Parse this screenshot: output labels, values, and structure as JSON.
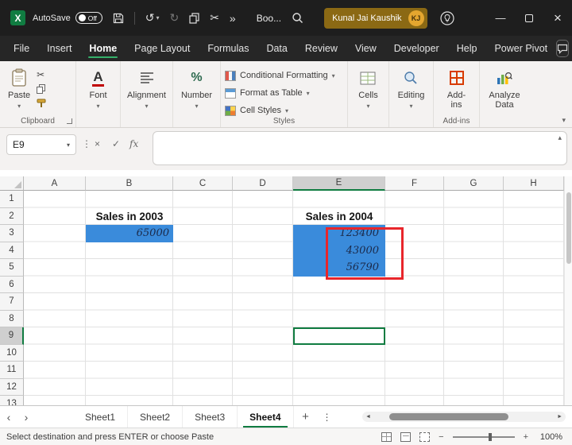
{
  "titlebar": {
    "autosave_label": "AutoSave",
    "autosave_state": "Off",
    "workbook_name": "Boo...",
    "user_name": "Kunal Jai Kaushik",
    "user_initials": "KJ",
    "logo_letter": "X"
  },
  "menu": {
    "items": [
      "File",
      "Insert",
      "Home",
      "Page Layout",
      "Formulas",
      "Data",
      "Review",
      "View",
      "Developer",
      "Help",
      "Power Pivot"
    ],
    "active": "Home"
  },
  "ribbon": {
    "paste": "Paste",
    "clipboard_group": "Clipboard",
    "font": "Font",
    "alignment": "Alignment",
    "number": "Number",
    "conditional_formatting": "Conditional Formatting",
    "format_as_table": "Format as Table",
    "cell_styles": "Cell Styles",
    "styles_group": "Styles",
    "cells": "Cells",
    "editing": "Editing",
    "addins": "Add-ins",
    "addins_group": "Add-ins",
    "analyze_data": "Analyze Data"
  },
  "formula_bar": {
    "name_box": "E9",
    "fx": "fx",
    "value": ""
  },
  "grid": {
    "columns": [
      "A",
      "B",
      "C",
      "D",
      "E",
      "F",
      "G",
      "H"
    ],
    "rows": [
      "1",
      "2",
      "3",
      "4",
      "5",
      "6",
      "7",
      "8",
      "9",
      "10",
      "11",
      "12",
      "13"
    ],
    "selected_cell": "E9",
    "cells": {
      "b2": "Sales in 2003",
      "b3": "65000",
      "e2": "Sales in 2004",
      "e3": "123400",
      "e4": "43000",
      "e5": "56790"
    }
  },
  "sheets": {
    "tabs": [
      "Sheet1",
      "Sheet2",
      "Sheet3",
      "Sheet4"
    ],
    "active": "Sheet4"
  },
  "status": {
    "message": "Select destination and press ENTER or choose Paste",
    "zoom": "100%"
  },
  "colors": {
    "excel_green": "#107C41",
    "blue_fill": "#3A8BDB",
    "red_highlight": "#E8262B"
  },
  "icons": {
    "undo": "↺",
    "redo": "↻",
    "scissors": "✂",
    "overflow": "»",
    "dropdown": "▾",
    "collapse_up": "▴",
    "ellipsis_v": "⋮",
    "cancel": "×",
    "check": "✓",
    "minimize": "—",
    "close": "×",
    "tab_prev": "‹",
    "tab_next": "›",
    "scroll_left": "◄",
    "scroll_right": "►",
    "add_sheet": "+",
    "font_a": "A",
    "percent": "%",
    "zoom_out": "−",
    "zoom_in": "+"
  }
}
